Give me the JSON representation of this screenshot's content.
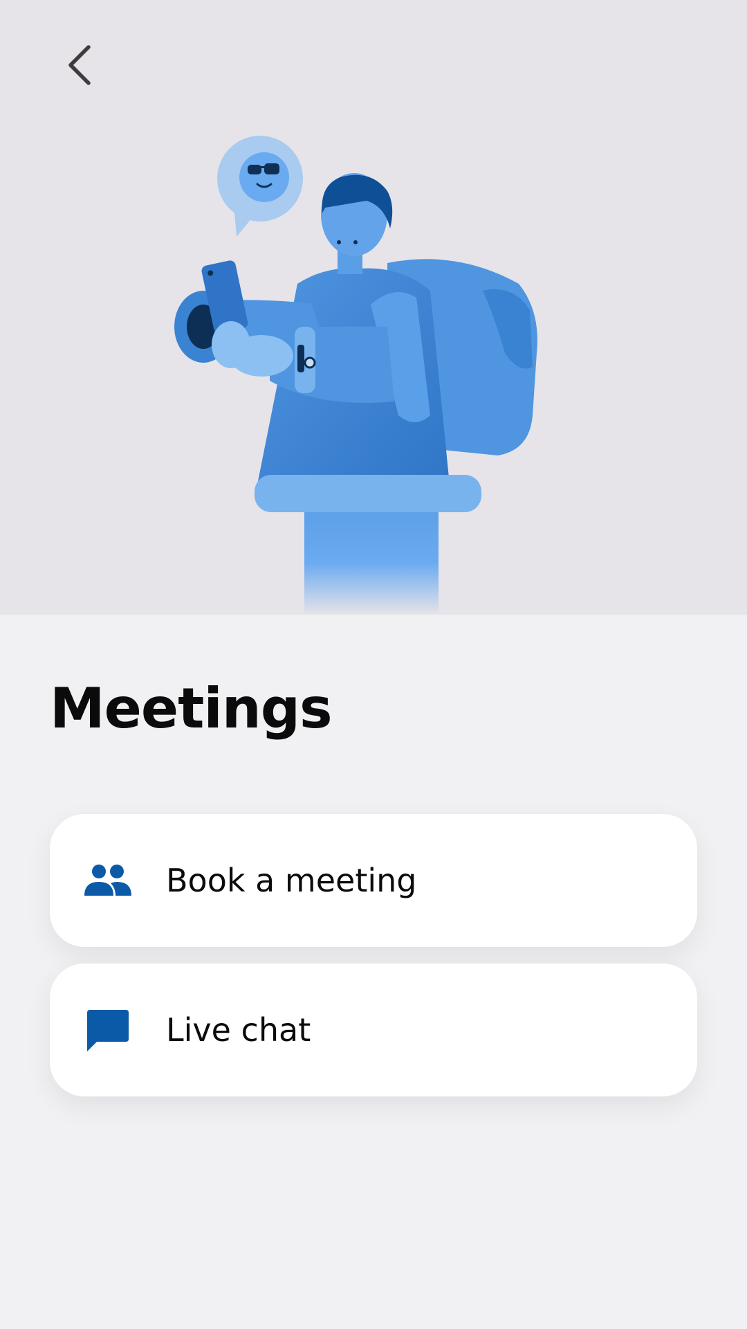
{
  "header": {
    "back_icon": "chevron-left-icon"
  },
  "hero": {
    "illustration": "person-with-backpack-using-phone",
    "accent_color": "#4a90dc"
  },
  "page": {
    "title": "Meetings"
  },
  "options": [
    {
      "label": "Book a meeting",
      "icon": "people-icon"
    },
    {
      "label": "Live chat",
      "icon": "chat-bubble-icon"
    }
  ],
  "colors": {
    "hero_background": "#e6e4e8",
    "page_background": "#f1f0f3",
    "icon": "#0a5aa8",
    "card": "#ffffff"
  }
}
